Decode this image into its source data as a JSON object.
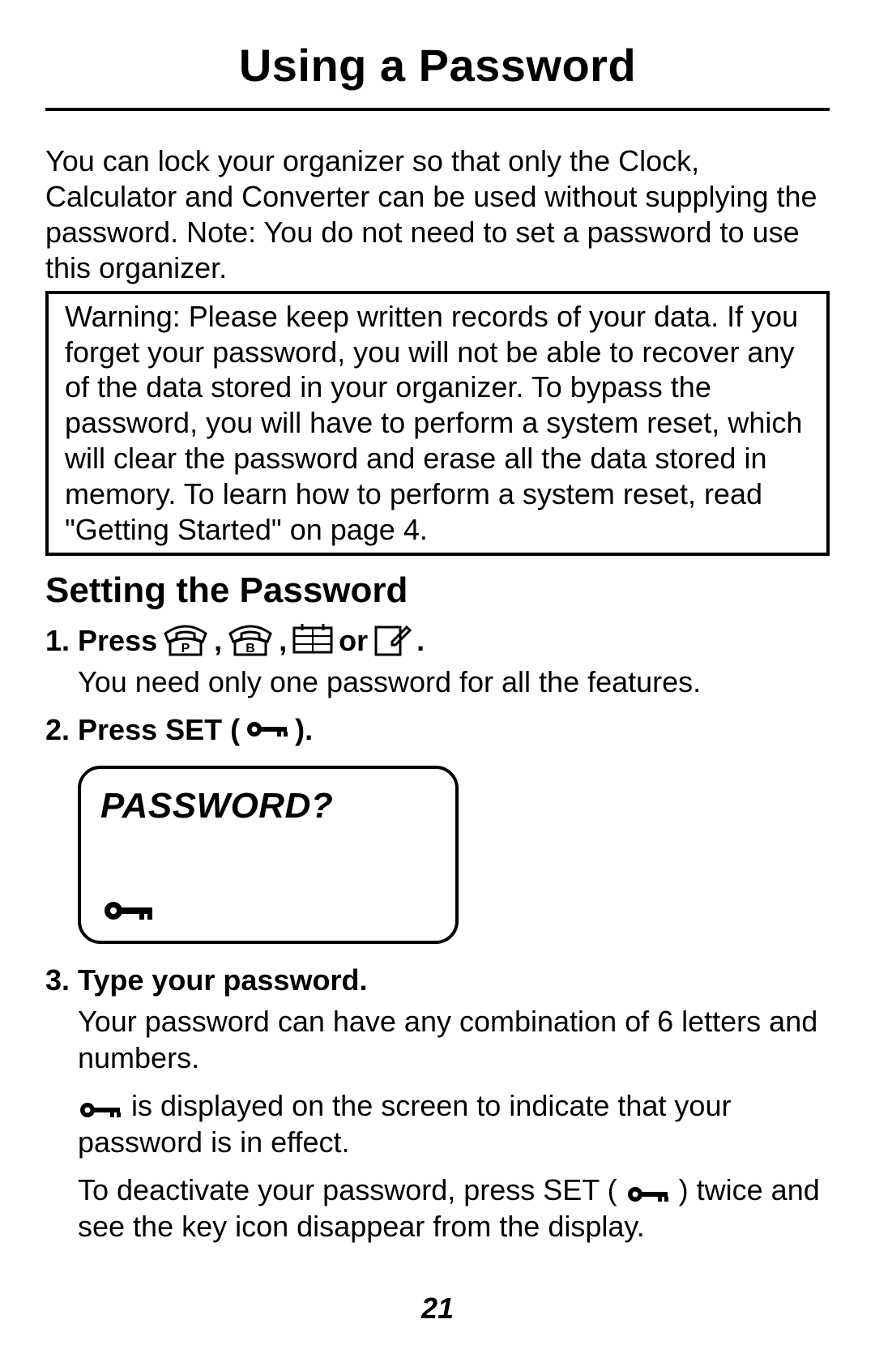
{
  "title": "Using a Password",
  "intro": "You can lock your organizer so that only the Clock, Calculator and Converter can be used without supplying the password. Note: You do not need to set a password to use this organizer.",
  "warning": "Warning: Please keep written records of your data. If you forget your password, you will not be able to recover any of the data stored in your organizer. To bypass the password, you will have to perform a system reset, which will clear the password and erase all the data stored in memory. To learn how to perform a system reset, read \"Getting Started\" on page 4.",
  "subhead": "Setting the Password",
  "step1_prefix": "1. Press",
  "step1_sep1": ",",
  "step1_sep2": ",",
  "step1_or": "or",
  "step1_end": ".",
  "step1_body": "You need only one password for all the features.",
  "step2_prefix": "2. Press SET (",
  "step2_suffix": ").",
  "display_text": "PASSWORD?",
  "step3": "3. Type your password.",
  "step3_body1": "Your password can have any combination of 6 letters and numbers.",
  "step3_body2a": " is displayed on the screen to indicate that your password is in effect.",
  "step3_body3a": "To deactivate your password, press SET (",
  "step3_body3b": ") twice and see the key icon disappear from the display.",
  "page_number": "21"
}
